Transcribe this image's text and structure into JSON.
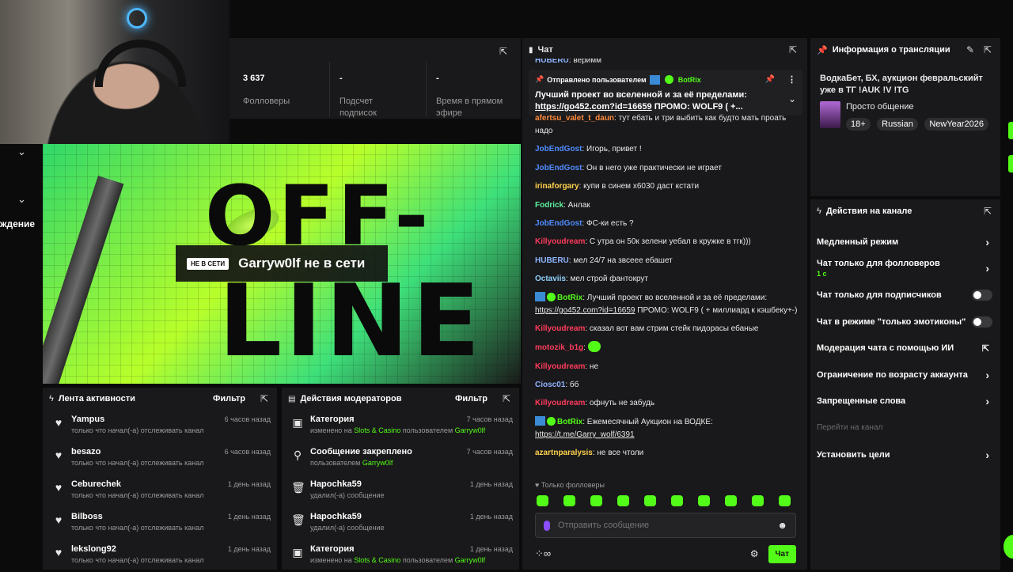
{
  "stats": {
    "followers_value": "3 637",
    "followers_label": "Фолловеры",
    "subs_value": "-",
    "subs_label": "Подсчет подписок",
    "airtime_value": "-",
    "airtime_label": "Время в прямом эфире"
  },
  "left_strip": {
    "label_fragment": "ждение"
  },
  "offline": {
    "tag": "НЕ В СЕТИ",
    "message": "Garryw0lf не в сети",
    "big_top": "OFF-",
    "big_bottom": "LINE"
  },
  "activity": {
    "title": "Лента активности",
    "filter": "Фильтр",
    "items": [
      {
        "name": "Yampus",
        "sub": "только что начал(-а) отслеживать канал",
        "time": "6 часов назад"
      },
      {
        "name": "besazo",
        "sub": "только что начал(-а) отслеживать канал",
        "time": "6 часов назад"
      },
      {
        "name": "Ceburechek",
        "sub": "только что начал(-а) отслеживать канал",
        "time": "1 день назад"
      },
      {
        "name": "Bilboss",
        "sub": "только что начал(-а) отслеживать канал",
        "time": "1 день назад"
      },
      {
        "name": "lekslong92",
        "sub": "только что начал(-а) отслеживать канал",
        "time": "1 день назад"
      }
    ]
  },
  "mod": {
    "title": "Действия модераторов",
    "filter": "Фильтр",
    "items": [
      {
        "name": "Категория",
        "sub_a": "изменено на ",
        "sub_b": "Slots & Casino",
        "sub_c": " пользователем ",
        "sub_d": "Garryw0lf",
        "time": "7 часов назад",
        "icon": "category-icon"
      },
      {
        "name": "Сообщение закреплено",
        "sub_a": "пользователем ",
        "sub_b": "Garryw0lf",
        "sub_c": "",
        "sub_d": "",
        "time": "7 часов назад",
        "icon": "pin-icon"
      },
      {
        "name": "Hapochka59",
        "sub_a": "удалил(-а) сообщение",
        "sub_b": "",
        "sub_c": "",
        "sub_d": "",
        "time": "1 день назад",
        "icon": "trash-icon"
      },
      {
        "name": "Hapochka59",
        "sub_a": "удалил(-а) сообщение",
        "sub_b": "",
        "sub_c": "",
        "sub_d": "",
        "time": "1 день назад",
        "icon": "trash-icon"
      },
      {
        "name": "Категория",
        "sub_a": "изменено на ",
        "sub_b": "Slots & Casino",
        "sub_c": " пользователем ",
        "sub_d": "Garryw0lf",
        "time": "1 день назад",
        "icon": "category-icon"
      }
    ]
  },
  "chat": {
    "title": "Чат",
    "pinned_by": "Отправлено пользователем",
    "pinned_user": "BotRix",
    "pinned_text": "Лучший проект во вселенной и за её пределами:",
    "pinned_link": "https://go452.com?id=16659",
    "pinned_tail": " ПРОМО: WOLF9 ( +...",
    "top_fragment_user": "HUBERU",
    "top_fragment_text": ": веримм",
    "messages": [
      {
        "user": "afertsu_valet_t_daun",
        "color": "#ff8a3d",
        "text": ": тут ебать и три выбить как будто мать проать надо"
      },
      {
        "user": "JobEndGost",
        "color": "#4f8cff",
        "text": ": Игорь, привет !"
      },
      {
        "user": "JobEndGost",
        "color": "#4f8cff",
        "text": ": Он в него уже практически не играет"
      },
      {
        "user": "irinaforgary",
        "color": "#ffd24d",
        "text": ": купи в синем х6030 даст кстати"
      },
      {
        "user": "Fodrick",
        "color": "#5ef2a0",
        "text": ": Анлак"
      },
      {
        "user": "JobEndGost",
        "color": "#4f8cff",
        "text": ": ФС-ки есть ?"
      },
      {
        "user": "Killyoudream",
        "color": "#ff3b5c",
        "text": ": С утра он 50к зелени уебал в кружке в тгк)))"
      },
      {
        "user": "HUBERU",
        "color": "#8fb4ff",
        "text": ": мел 24/7 на звсеее ебашет"
      },
      {
        "user": "Octaviis",
        "color": "#8fd3ff",
        "text": ": мел строй фантокрут"
      },
      {
        "user": "BotRix",
        "color": "#53fc18",
        "text": ": Лучший проект во вселенной и за её пределами: ",
        "link": "https://go452.com?id=16659",
        "tail": " ПРОМО: WOLF9 ( + миллиард к кэшбеку+-)",
        "bot": true
      },
      {
        "user": "Killyoudream",
        "color": "#ff3b5c",
        "text": ": сказал вот вам стрим стейк пидорасы ебаные"
      },
      {
        "user": "motozik_b1g",
        "color": "#ff3b5c",
        "text": ": ",
        "emote": true
      },
      {
        "user": "Killyoudream",
        "color": "#ff3b5c",
        "text": ": не"
      },
      {
        "user": "Ciosc01",
        "color": "#8fb4ff",
        "text": ": бб"
      },
      {
        "user": "Killyoudream",
        "color": "#ff3b5c",
        "text": ": офнуть не забудь"
      },
      {
        "user": "BotRix",
        "color": "#53fc18",
        "text": ": Ежемесячный Аукцион на ВОДКЕ: ",
        "link": "https://t.me/Garry_wolf/6391",
        "tail": "",
        "bot": true
      },
      {
        "user": "azartnparalysis",
        "color": "#ffd24d",
        "text": ": не все чтоли"
      }
    ],
    "followers_only": "Только фолловеры",
    "input_placeholder": "Отправить сообщение",
    "send_label": "Чат"
  },
  "info": {
    "title": "Информация о трансляции",
    "stream_title": "ВодкаБет, БХ, аукцион февральскийт уже в ТГ !AUK !V !TG",
    "category": "Просто общение",
    "tags": [
      "18+",
      "Russian",
      "NewYear2026"
    ]
  },
  "actions": {
    "title": "Действия на канале",
    "slow_mode": "Медленный режим",
    "followers_only": "Чат только для фолловеров",
    "followers_only_value": "1 с",
    "subs_only": "Чат только для подписчиков",
    "emote_only": "Чат в режиме \"только эмотиконы\"",
    "ai_mod": "Модерация чата с помощью ИИ",
    "age_limit": "Ограничение по возрасту аккаунта",
    "banned_words": "Запрещенные слова",
    "goto_channel": "Перейти на канал",
    "set_goals": "Установить цели"
  },
  "colors": {
    "accent": "#53fc18",
    "panel": "#19191b",
    "bg": "#0b0b0c"
  }
}
